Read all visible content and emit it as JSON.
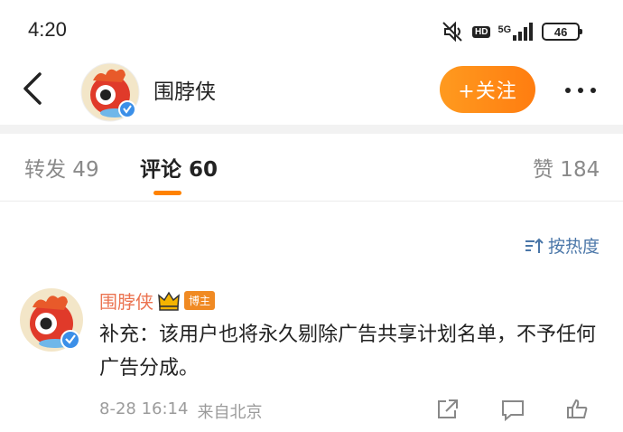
{
  "status_bar": {
    "time": "4:20",
    "hd_label": "HD",
    "network_label": "5G",
    "battery_level": "46"
  },
  "nav": {
    "title": "围脖侠",
    "follow_label": "+关注"
  },
  "tabs": {
    "repost": "转发 49",
    "comment": "评论 60",
    "likes": "赞 184"
  },
  "sort_label": "按热度",
  "comment": {
    "author": "围脖侠",
    "badge": "博主",
    "text": "补充：该用户也将永久剔除广告共享计划名单，不予任何广告分成。",
    "date": "8-28 16:14",
    "source": "来自北京"
  },
  "colors": {
    "accent_orange": "#ff8200",
    "username_orange": "#eb7350",
    "verified_blue": "#3b8fe8",
    "link_blue": "#4a76a8"
  }
}
